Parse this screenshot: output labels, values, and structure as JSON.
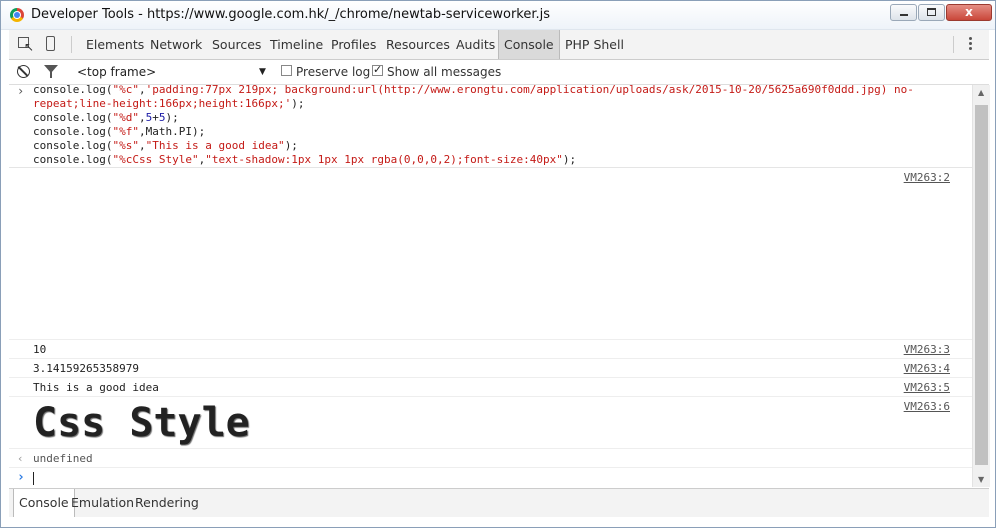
{
  "window": {
    "title": "Developer Tools - https://www.google.com.hk/_/chrome/newtab-serviceworker.js",
    "close_glyph": "x"
  },
  "toolbar": {
    "tabs": [
      "Elements",
      "Network",
      "Sources",
      "Timeline",
      "Profiles",
      "Resources",
      "Audits",
      "Console",
      "PHP Shell"
    ],
    "active_tab": "Console",
    "icons": [
      "inspect-element-icon",
      "device-mode-icon",
      "more-menu-icon"
    ]
  },
  "filterbar": {
    "frame": "<top frame>",
    "dropdown_glyph": "▼",
    "preserve_log_label": "Preserve log",
    "preserve_log_checked": false,
    "show_all_label": "Show all messages",
    "show_all_checked": true,
    "icons": [
      "clear-console-icon",
      "filter-icon"
    ]
  },
  "console": {
    "prompt_glyph": "›",
    "result_glyph": "‹",
    "code": [
      {
        "pre": "console.log(",
        "s1": "\"%c\"",
        "mid": ",",
        "s2": "'padding:77px 219px; background:url(http://www.erongtu.com/application/uploads/ask/2015-10-20/5625a690f0ddd.jpg) no-"
      },
      {
        "s": "repeat;line-height:166px;height:166px;'",
        "post": ");"
      },
      {
        "pre": "console.log(",
        "s": "\"%d\"",
        "mid": ",",
        "n1": "5",
        "op": "+",
        "n2": "5",
        "post": ");"
      },
      {
        "pre": "console.log(",
        "s": "\"%f\"",
        "post": ",Math.PI);"
      },
      {
        "pre": "console.log(",
        "s1": "\"%s\"",
        "mid": ",",
        "s2": "\"This is a good idea\"",
        "post": ");"
      },
      {
        "pre": "console.log(",
        "s1": "\"%cCss Style\"",
        "mid": ",",
        "s2": "\"text-shadow:1px 1px 1px rgba(0,0,0,2);font-size:40px\"",
        "post": ");"
      }
    ],
    "messages": [
      {
        "text": "",
        "source": "VM263:2"
      },
      {
        "text": "10",
        "source": "VM263:3"
      },
      {
        "text": "3.14159265358979",
        "source": "VM263:4"
      },
      {
        "text": "This is a good idea",
        "source": "VM263:5"
      },
      {
        "text": "Css Style",
        "source": "VM263:6"
      }
    ],
    "result": "undefined"
  },
  "drawer": {
    "tabs": [
      "Console",
      "Emulation",
      "Rendering"
    ],
    "active_tab": "Console"
  },
  "colors": {
    "string": "#c41a16",
    "number": "#1a1aa6",
    "active_tab_bg": "#dadada",
    "prompt_accent": "#2a7ae2"
  }
}
